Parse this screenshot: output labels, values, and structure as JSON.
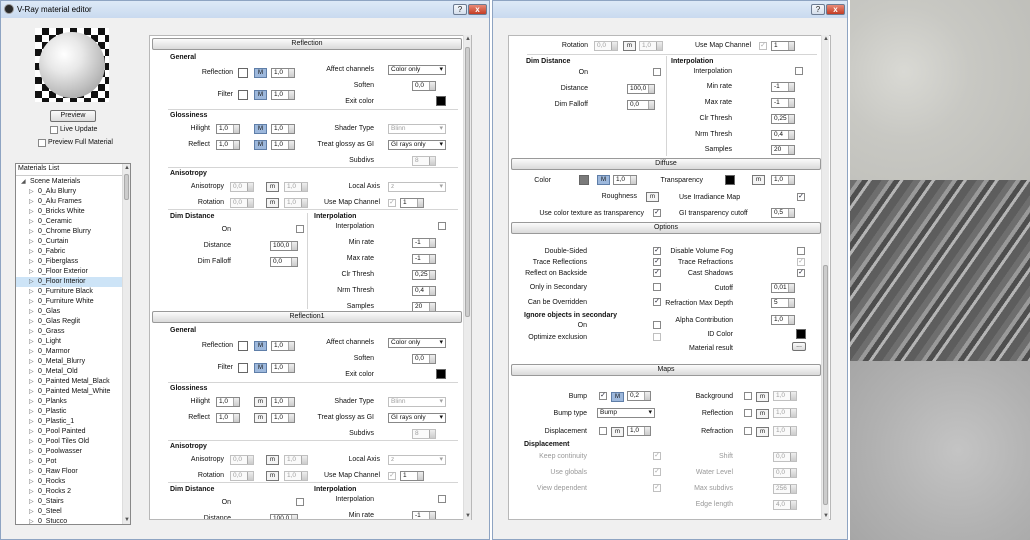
{
  "window1": {
    "title": "V-Ray material editor",
    "help": "?",
    "close": "x"
  },
  "window2": {
    "help": "?",
    "close": "x"
  },
  "left": {
    "preview_button": "Preview",
    "live_update": "Live Update",
    "preview_full": "Preview Full Material",
    "materials_label": "Materials List",
    "items": [
      "Scene Materials",
      "0_Alu Blurry",
      "0_Alu Frames",
      "0_Bricks White",
      "0_Ceramic",
      "0_Chrome Blurry",
      "0_Curtain",
      "0_Fabric",
      "0_Fiberglass",
      "0_Floor Exterior",
      "0_Floor Interior",
      "0_Furniture Black",
      "0_Furniture White",
      "0_Glas",
      "0_Glas Reglit",
      "0_Grass",
      "0_Light",
      "0_Marmor",
      "0_Metal_Blurry",
      "0_Metal_Old",
      "0_Painted Metal_Black",
      "0_Painted Metal_White",
      "0_Planks",
      "0_Plastic",
      "0_Plastic_1",
      "0_Pool Painted",
      "0_Pool Tiles Old",
      "0_Poolwasser",
      "0_Pot",
      "0_Raw Floor",
      "0_Rocks",
      "0_Rocks 2",
      "0_Stairs",
      "0_Steel",
      "0_Stucco"
    ]
  },
  "reflection": {
    "header": "Reflection",
    "general": "General",
    "reflection_lbl": "Reflection",
    "reflection_val": "1,0",
    "filter_lbl": "Filter",
    "filter_val": "1,0",
    "affect_lbl": "Affect channels",
    "affect_val": "Color only",
    "soften_lbl": "Soften",
    "soften_val": "0,0",
    "exit_lbl": "Exit color",
    "gloss": "Glossiness",
    "hilight_lbl": "Hilight",
    "hilight_a": "1,0",
    "hilight_b": "1,0",
    "reflect_lbl": "Reflect",
    "reflect_a": "1,0",
    "reflect_b": "1,0",
    "shader_lbl": "Shader Type",
    "shader_val": "Blinn",
    "treat_lbl": "Treat glossy as GI",
    "treat_val": "GI rays only",
    "subdivs_lbl": "Subdivs",
    "subdivs_val": "8",
    "aniso": "Anisotropy",
    "aniso_lbl": "Anisotropy",
    "aniso_a": "0,0",
    "aniso_b": "1,0",
    "rot_lbl": "Rotation",
    "rot_a": "0,0",
    "rot_b": "1,0",
    "local_lbl": "Local Axis",
    "local_val": "z",
    "usemap_lbl": "Use Map Channel",
    "usemap_val": "1",
    "dim": "Dim Distance",
    "on_lbl": "On",
    "dist_lbl": "Distance",
    "dist_val": "100,0",
    "falloff_lbl": "Dim Falloff",
    "falloff_val": "0,0",
    "interp": "Interpolation",
    "interp_lbl": "Interpolation",
    "minrate_lbl": "Min rate",
    "minrate_val": "-1",
    "maxrate_lbl": "Max rate",
    "maxrate_val": "-1",
    "clr_lbl": "Clr Thresh",
    "clr_val": "0,25",
    "nrm_lbl": "Nrm Thresh",
    "nrm_val": "0,4",
    "samples_lbl": "Samples",
    "samples_val": "20"
  },
  "reflection1": {
    "header": "Reflection1",
    "general": "General",
    "reflection_lbl": "Reflection",
    "reflection_val": "1,0",
    "filter_lbl": "Filter",
    "filter_val": "1,0",
    "affect_lbl": "Affect channels",
    "affect_val": "Color only",
    "soften_lbl": "Soften",
    "soften_val": "0,0",
    "exit_lbl": "Exit color",
    "gloss": "Glossiness",
    "hilight_lbl": "Hilight",
    "hilight_a": "1,0",
    "hilight_b": "1,0",
    "reflect_lbl": "Reflect",
    "reflect_a": "1,0",
    "reflect_b": "1,0",
    "shader_lbl": "Shader Type",
    "shader_val": "Blinn",
    "treat_lbl": "Treat glossy as GI",
    "treat_val": "GI rays only",
    "subdivs_lbl": "Subdivs",
    "subdivs_val": "8",
    "aniso": "Anisotropy",
    "aniso_lbl": "Anisotropy",
    "aniso_a": "0,0",
    "aniso_b": "1,0",
    "rot_lbl": "Rotation",
    "rot_a": "0,0",
    "rot_b": "1,0",
    "local_lbl": "Local Axis",
    "local_val": "z",
    "usemap_lbl": "Use Map Channel",
    "usemap_val": "1",
    "dim": "Dim Distance",
    "on_lbl": "On",
    "dist_lbl": "Distance",
    "dist_val": "100,0",
    "interp": "Interpolation",
    "interp_lbl": "Interpolation",
    "minrate_lbl": "Min rate",
    "minrate_val": "-1"
  },
  "right_top": {
    "rot_lbl": "Rotation",
    "rot_a": "0,0",
    "rot_b": "1,0",
    "usemap_lbl": "Use Map Channel",
    "usemap_val": "1",
    "dim": "Dim Distance",
    "on_lbl": "On",
    "dist_lbl": "Distance",
    "dist_val": "100,0",
    "falloff_lbl": "Dim Falloff",
    "falloff_val": "0,0",
    "interp": "Interpolation",
    "interp_lbl": "Interpolation",
    "minrate_lbl": "Min rate",
    "minrate_val": "-1",
    "maxrate_lbl": "Max rate",
    "maxrate_val": "-1",
    "clr_lbl": "Clr Thresh",
    "clr_val": "0,25",
    "nrm_lbl": "Nrm Thresh",
    "nrm_val": "0,4",
    "samples_lbl": "Samples",
    "samples_val": "20"
  },
  "diffuse": {
    "header": "Diffuse",
    "color_lbl": "Color",
    "color_val": "1,0",
    "transp_lbl": "Transparency",
    "transp_val": "1,0",
    "rough_lbl": "Roughness",
    "irr_lbl": "Use Irradiance Map",
    "usecol_lbl": "Use color texture as transparency",
    "gicut_lbl": "GI transparency cutoff",
    "gicut_val": "0,5"
  },
  "options": {
    "header": "Options",
    "ds": "Double-Sided",
    "tr": "Trace Reflections",
    "rb": "Reflect on Backside",
    "os": "Only in Secondary",
    "co": "Can be Overridden",
    "ig": "Ignore objects in secondary",
    "on_lbl": "On",
    "opt": "Optimize exclusion",
    "dvf": "Disable Volume Fog",
    "trr": "Trace Refractions",
    "cs": "Cast Shadows",
    "cut_lbl": "Cutoff",
    "cut_val": "0,01",
    "rmd_lbl": "Refraction Max Depth",
    "rmd_val": "5",
    "alpha_lbl": "Alpha Contribution",
    "alpha_val": "1,0",
    "id_lbl": "ID Color",
    "mat_lbl": "Material result",
    "mat_btn": "..."
  },
  "maps": {
    "header": "Maps",
    "bump_lbl": "Bump",
    "bump_val": "0,2",
    "bumptype_lbl": "Bump type",
    "bumptype_val": "Bump",
    "disp_lbl": "Displacement",
    "disp_val": "1,0",
    "bg_lbl": "Background",
    "bg_val": "1,0",
    "refl_lbl": "Reflection",
    "refl_val": "1,0",
    "refr_lbl": "Refraction",
    "refr_val": "1,0",
    "dsp": "Displacement",
    "kc": "Keep continuity",
    "ug": "Use globals",
    "vd": "View dependent",
    "shift_lbl": "Shift",
    "shift_val": "0,0",
    "wl_lbl": "Water Level",
    "wl_val": "0,0",
    "ms_lbl": "Max subdivs",
    "ms_val": "256",
    "el_lbl": "Edge length",
    "el_val": "4,0"
  },
  "icons": {
    "m": "m",
    "M": "M",
    "check": "✓"
  }
}
